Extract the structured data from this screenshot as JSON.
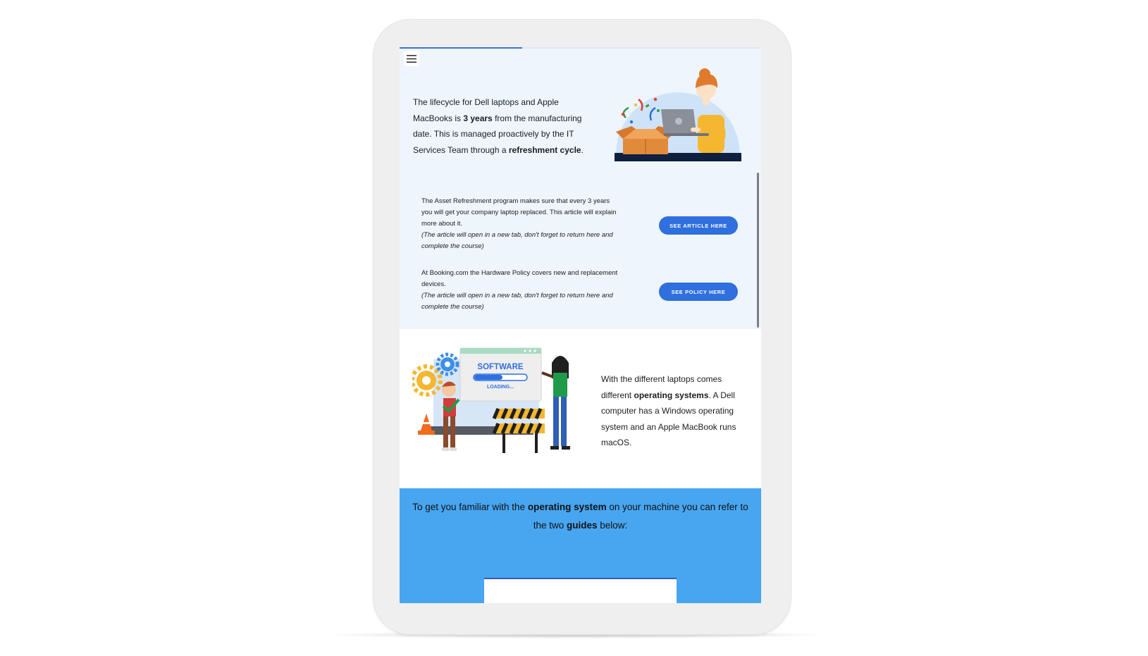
{
  "course": {
    "progress_fraction": 0.34,
    "menu_icon": "hamburger-menu-icon"
  },
  "intro": {
    "t1": "The lifecycle for Dell laptops and Apple MacBooks is ",
    "b1": "3 years",
    "t2": " from the manufacturing date. This is managed proactively by the IT Services Team through a ",
    "b2": "refreshment cycle",
    "t3": "."
  },
  "article_callout": {
    "text": "The Asset Refreshment program makes sure that every 3 years you will get your company laptop replaced. This article will explain more about it.",
    "note": "(The article will open in a new tab, don't forget to return here and complete the course)",
    "button": "SEE ARTICLE HERE"
  },
  "policy_callout": {
    "text": "At Booking.com the Hardware Policy covers new and replacement devices.",
    "note": "(The article will open in a new tab, don't forget to return here and complete the course)",
    "button": "SEE POLICY HERE"
  },
  "software_illustration": {
    "title": "SOFTWARE",
    "loading": "LOADING..."
  },
  "os": {
    "t1": "With the different laptops comes different ",
    "b1": "operating systems",
    "t2": ". A Dell computer has a Windows operating system and an Apple MacBook runs macOS."
  },
  "guides": {
    "t1": "To get you familiar with the ",
    "b1": "operating system",
    "t2": " on your machine you can refer to the two ",
    "b2": "guides",
    "t3": " below:"
  },
  "colors": {
    "accent_blue": "#2f6fde",
    "section_light": "#eef5fd",
    "section_blue": "#48a6f1"
  }
}
